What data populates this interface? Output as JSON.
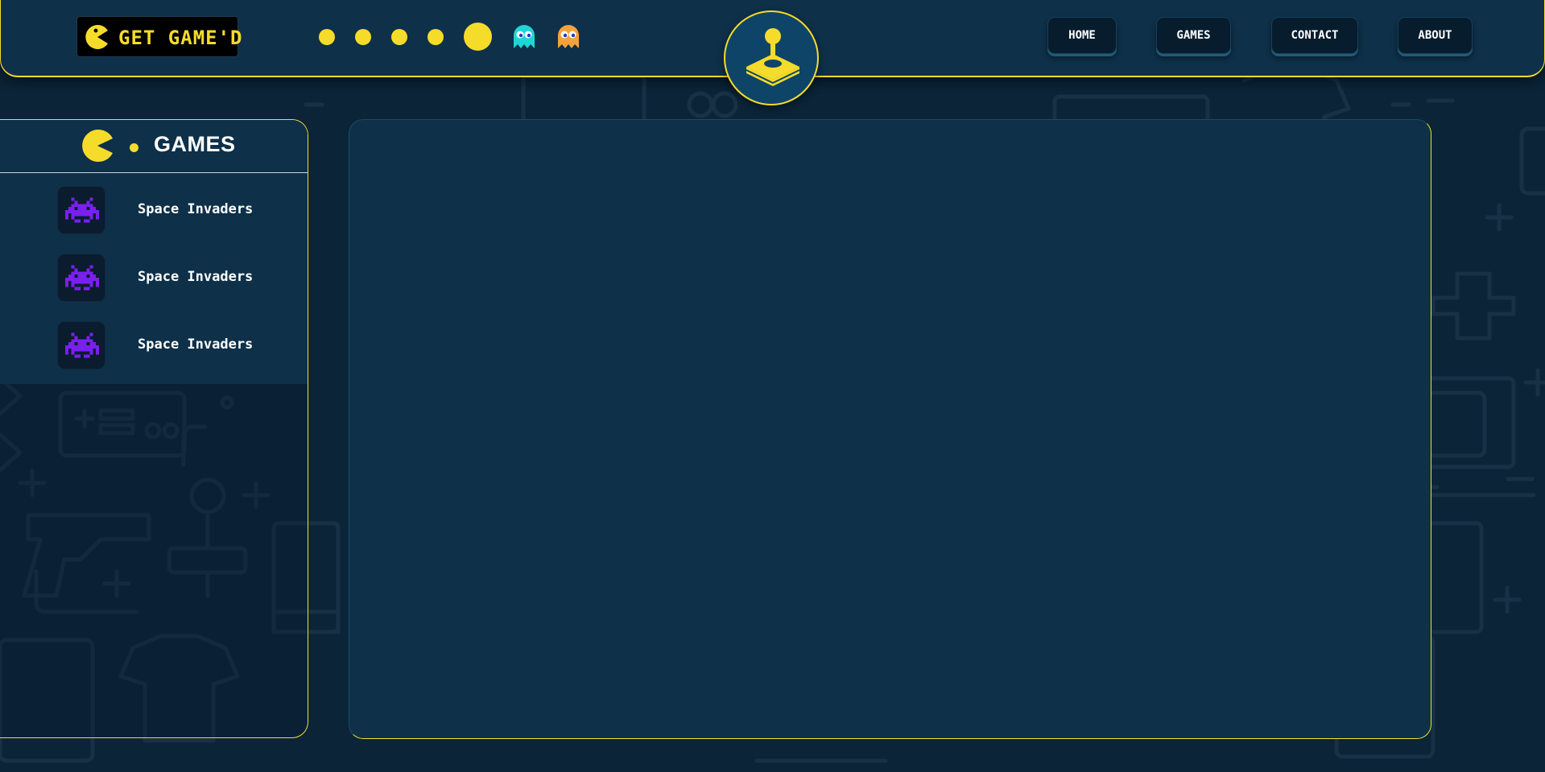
{
  "brand": {
    "logo_text": "GET GAME'D",
    "logo_icon": "pacman-icon"
  },
  "header": {
    "decor": [
      "pellet",
      "pellet",
      "pellet",
      "pellet",
      "power-pellet",
      "ghost-cyan",
      "ghost-orange"
    ],
    "center_icon": "joystick-icon",
    "nav": [
      {
        "label": "HOME"
      },
      {
        "label": "GAMES"
      },
      {
        "label": "CONTACT"
      },
      {
        "label": "ABOUT"
      }
    ]
  },
  "sidebar": {
    "title": "GAMES",
    "title_icon": "pacman-icon",
    "games": [
      {
        "label": "Space Invaders",
        "icon": "space-invader-icon"
      },
      {
        "label": "Space Invaders",
        "icon": "space-invader-icon"
      },
      {
        "label": "Space Invaders",
        "icon": "space-invader-icon"
      }
    ]
  },
  "colors": {
    "accent": "#f6dc2a",
    "panel": "#0e3049",
    "background": "#0b2438",
    "nav_button": "#071c2d",
    "invader": "#7a1ff0",
    "ghost_cyan": "#1fd6d6",
    "ghost_orange": "#f3a33c"
  }
}
